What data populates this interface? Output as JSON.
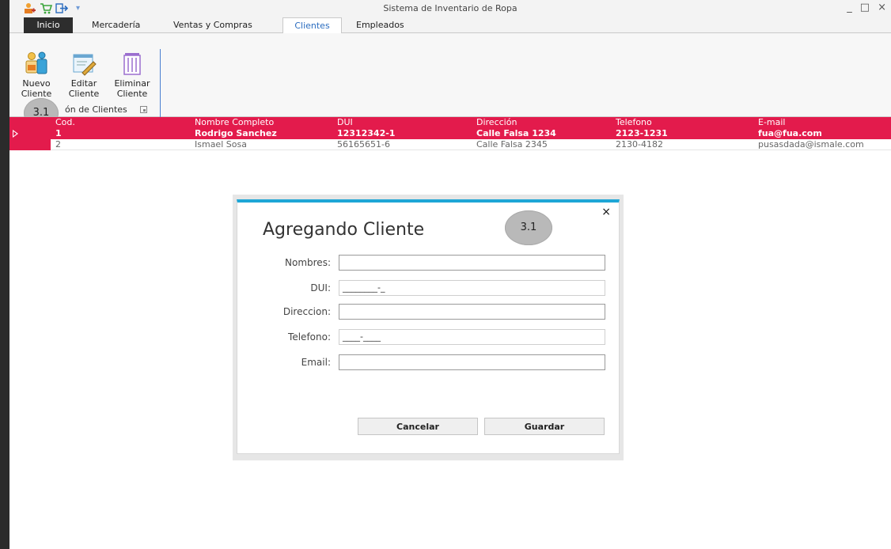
{
  "app": {
    "title": "Sistema de Inventario de Ropa"
  },
  "window_controls": {
    "minimize": "_",
    "maximize": "□",
    "close": "×"
  },
  "tabs": [
    {
      "label": "Inicio"
    },
    {
      "label": "Mercadería"
    },
    {
      "label": "Ventas y Compras"
    },
    {
      "label": "Clientes",
      "active": true
    },
    {
      "label": "Empleados"
    }
  ],
  "ribbon": {
    "buttons": {
      "nuevo": {
        "line1": "Nuevo",
        "line2": "Cliente"
      },
      "editar": {
        "line1": "Editar",
        "line2": "Cliente"
      },
      "eliminar": {
        "line1": "Eliminar",
        "line2": "Cliente"
      }
    },
    "group_label": "ón de Clientes"
  },
  "callouts": {
    "ribbon": "3.1",
    "dialog": "3.1"
  },
  "grid": {
    "columns": [
      "Cod.",
      "Nombre Completo",
      "DUI",
      "Dirección",
      "Telefono",
      "E-mail"
    ],
    "rows": [
      {
        "cells": [
          "1",
          "Rodrigo Sanchez",
          "12312342-1",
          "Calle Falsa 1234",
          "2123-1231",
          "fua@fua.com"
        ],
        "selected": true
      },
      {
        "cells": [
          "2",
          "Ismael Sosa",
          "56165651-6",
          "Calle Falsa 2345",
          "2130-4182",
          "pusasdada@ismale.com"
        ],
        "selected": false
      }
    ]
  },
  "dialog": {
    "title": "Agregando Cliente",
    "close": "×",
    "fields": {
      "nombres": {
        "label": "Nombres:",
        "value": ""
      },
      "dui": {
        "label": "DUI:",
        "value": "________-_"
      },
      "direccion": {
        "label": "Direccion:",
        "value": ""
      },
      "telefono": {
        "label": "Telefono:",
        "value": "____-____"
      },
      "email": {
        "label": "Email:",
        "value": ""
      }
    },
    "buttons": {
      "cancel": "Cancelar",
      "save": "Guardar"
    }
  },
  "colors": {
    "accent_red": "#e31b4c",
    "dialog_top": "#1ea6d6",
    "tab_active_text": "#2a6cbf"
  }
}
